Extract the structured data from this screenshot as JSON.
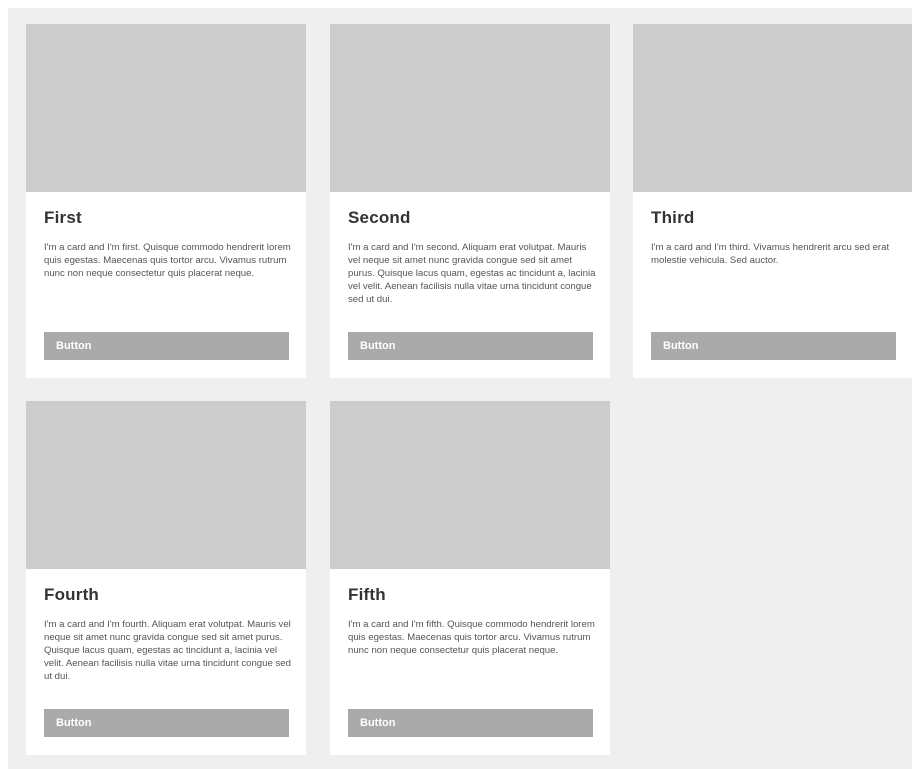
{
  "cards": [
    {
      "title": "First",
      "text": "I'm a card and I'm first. Quisque commodo hendrerit lorem quis egestas. Maecenas quis tortor arcu. Vivamus rutrum nunc non neque consectetur quis placerat neque.",
      "button_label": "Button"
    },
    {
      "title": "Second",
      "text": "I'm a card and I'm second. Aliquam erat volutpat. Mauris vel neque sit amet nunc gravida congue sed sit amet purus. Quisque lacus quam, egestas ac tincidunt a, lacinia vel velit. Aenean facilisis nulla vitae urna tincidunt congue sed ut dui.",
      "button_label": "Button"
    },
    {
      "title": "Third",
      "text": "I'm a card and I'm third. Vivamus hendrerit arcu sed erat molestie vehicula. Sed auctor.",
      "button_label": "Button"
    },
    {
      "title": "Fourth",
      "text": "I'm a card and I'm fourth. Aliquam erat volutpat. Mauris vel neque sit amet nunc gravida congue sed sit amet purus. Quisque lacus quam, egestas ac tincidunt a, lacinia vel velit. Aenean facilisis nulla vitae urna tincidunt congue sed ut dui.",
      "button_label": "Button"
    },
    {
      "title": "Fifth",
      "text": "I'm a card and I'm fifth. Quisque commodo hendrerit lorem quis egestas. Maecenas quis tortor arcu. Vivamus rutrum nunc non neque consectetur quis placerat neque.",
      "button_label": "Button"
    }
  ],
  "colors": {
    "page_background": "#efefef",
    "card_background": "#ffffff",
    "image_placeholder": "#cccccc",
    "button_background": "#aaaaaa",
    "button_text": "#ffffff",
    "title_text": "#333333",
    "body_text": "#555555"
  }
}
